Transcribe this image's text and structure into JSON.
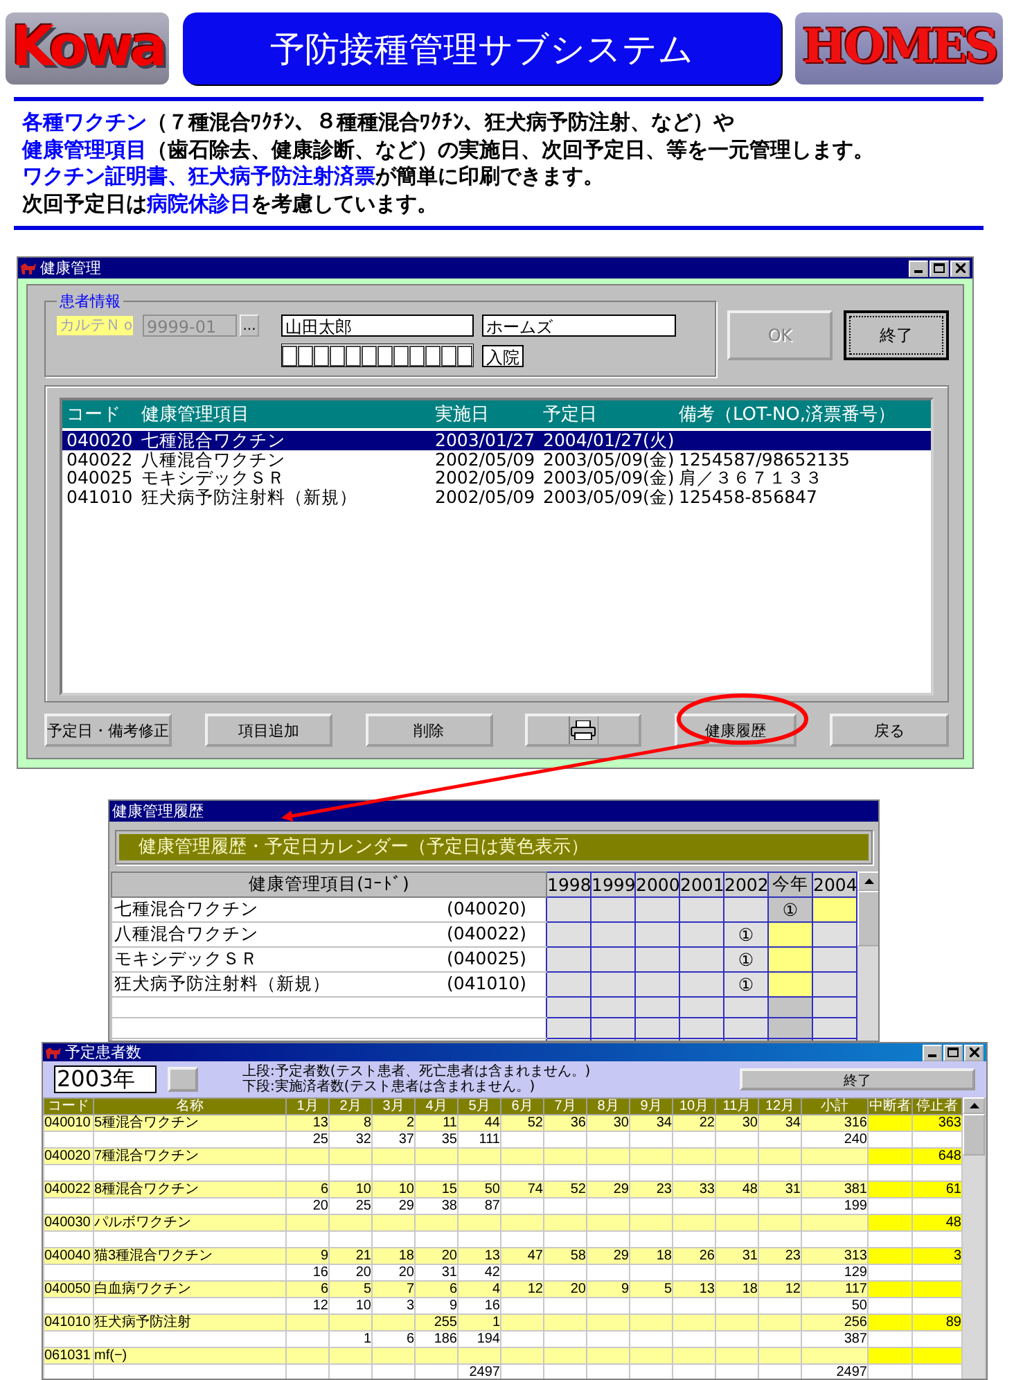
{
  "header": {
    "logo_left": "Kowa",
    "title": "予防接種管理サブシステム",
    "logo_right": "HOMES"
  },
  "intro": [
    [
      {
        "kind": "highlight",
        "text": "各種ワクチン"
      },
      {
        "kind": "plain",
        "text": "（７種混合ﾜｸﾁﾝ、８種種混合ﾜｸﾁﾝ、狂犬病予防注射、など）や"
      }
    ],
    [
      {
        "kind": "highlight",
        "text": "健康管理項目"
      },
      {
        "kind": "plain",
        "text": "（歯石除去、健康診断、など）の実施日、次回予定日、等を一元管理します。"
      }
    ],
    [
      {
        "kind": "highlight",
        "text": "ワクチン証明書、狂犬病予防注射済票"
      },
      {
        "kind": "plain",
        "text": "が簡単に印刷できます。"
      }
    ],
    [
      {
        "kind": "plain",
        "text": "次回予定日は"
      },
      {
        "kind": "highlight",
        "text": "病院休診日"
      },
      {
        "kind": "plain",
        "text": "を考慮しています。"
      }
    ]
  ],
  "health_window": {
    "title": "健康管理",
    "has_controls": true,
    "group": "患者情報",
    "karte_label": "カルテＮｏ",
    "karte_no": "9999-01",
    "browse": "...",
    "name": "山田太郎",
    "kana": "ホームズ",
    "status": "入院",
    "top_buttons": [
      {
        "label": "OK",
        "disabled": true
      },
      {
        "label": "終了",
        "disabled": false
      }
    ],
    "list": {
      "columns": [
        "コード",
        "健康管理項目",
        "実施日",
        "予定日",
        "備考（LOT-NO,済票番号）"
      ],
      "rows": [
        {
          "code": "040020",
          "item": "七種混合ワクチン",
          "done": "2003/01/27",
          "next": "2004/01/27(火)",
          "selected": true
        },
        {
          "code": "040022",
          "item": "八種混合ワクチン",
          "done": "2002/05/09",
          "next": "2003/05/09(金)",
          "note": "1254587/98652135",
          "selected": false
        },
        {
          "code": "040025",
          "item": "モキシデックＳＲ",
          "done": "2002/05/09",
          "next": "2003/05/09(金)",
          "note": "肩／３６７１３３",
          "selected": false
        },
        {
          "code": "041010",
          "item": "狂犬病予防注射料（新規）",
          "done": "2002/05/09",
          "next": "2003/05/09(金)",
          "note": "125458-856847",
          "selected": false
        }
      ]
    },
    "bottom_buttons": [
      {
        "kind": "text",
        "label": "予定日・備考修正"
      },
      {
        "kind": "text",
        "label": "項目追加"
      },
      {
        "kind": "text",
        "label": "削除"
      },
      {
        "kind": "print"
      },
      {
        "kind": "text",
        "label": "健康履歴"
      },
      {
        "kind": "text",
        "label": "戻る"
      }
    ]
  },
  "history_window": {
    "title": "健康管理履歴",
    "banner": "健康管理履歴・予定日カレンダー（予定日は黄色表示）",
    "item_header": "健康管理項目(ｺｰﾄﾞ)",
    "years": [
      {
        "label": "1998",
        "current": false
      },
      {
        "label": "1999",
        "current": false
      },
      {
        "label": "2000",
        "current": false
      },
      {
        "label": "2001",
        "current": false
      },
      {
        "label": "2002",
        "current": false
      },
      {
        "label": "今年",
        "current": true
      },
      {
        "label": "2004",
        "current": false
      }
    ],
    "rows": [
      {
        "name": "七種混合ワクチン",
        "code": "(040020)",
        "cells": [
          {
            "scheduled": false
          },
          {
            "scheduled": false
          },
          {
            "scheduled": false
          },
          {
            "scheduled": false
          },
          {
            "scheduled": false
          },
          {
            "entry": "①",
            "scheduled": false
          },
          {
            "scheduled": true
          }
        ]
      },
      {
        "name": "八種混合ワクチン",
        "code": "(040022)",
        "cells": [
          {
            "scheduled": false
          },
          {
            "scheduled": false
          },
          {
            "scheduled": false
          },
          {
            "scheduled": false
          },
          {
            "entry": "①",
            "scheduled": false
          },
          {
            "scheduled": true
          },
          {
            "scheduled": false
          }
        ]
      },
      {
        "name": "モキシデックＳＲ",
        "code": "(040025)",
        "cells": [
          {
            "scheduled": false
          },
          {
            "scheduled": false
          },
          {
            "scheduled": false
          },
          {
            "scheduled": false
          },
          {
            "entry": "①",
            "scheduled": false
          },
          {
            "scheduled": true
          },
          {
            "scheduled": false
          }
        ]
      },
      {
        "name": "狂犬病予防注射料（新規）",
        "code": "(041010)",
        "cells": [
          {
            "scheduled": false
          },
          {
            "scheduled": false
          },
          {
            "scheduled": false
          },
          {
            "scheduled": false
          },
          {
            "entry": "①",
            "scheduled": false
          },
          {
            "scheduled": true
          },
          {
            "scheduled": false
          }
        ]
      }
    ]
  },
  "schedule_window": {
    "title": "予定患者数",
    "has_controls": true,
    "year": "2003年",
    "legend": [
      "上段:予定者数(テスト患者、死亡患者は含まれません。)",
      "下段:実施済者数(テスト患者は含まれません。)"
    ],
    "close": "終了",
    "columns": [
      "コード",
      "名称",
      "1月",
      "2月",
      "3月",
      "4月",
      "5月",
      "6月",
      "7月",
      "8月",
      "9月",
      "10月",
      "11月",
      "12月",
      "小計",
      "中断者",
      "停止者"
    ],
    "rows": [
      {
        "code": "040010",
        "name": "5種混合ワクチン",
        "stopped": "363",
        "planned": {
          "m1": "13",
          "m2": "8",
          "m3": "2",
          "m4": "11",
          "m5": "44",
          "m6": "52",
          "m7": "36",
          "m8": "30",
          "m9": "34",
          "m10": "22",
          "m11": "30",
          "m12": "34",
          "subtotal": "316"
        },
        "done": {
          "m1": "25",
          "m2": "32",
          "m3": "37",
          "m4": "35",
          "m5": "111",
          "subtotal": "240"
        }
      },
      {
        "code": "040020",
        "name": "7種混合ワクチン",
        "stopped": "648"
      },
      {
        "code": "040022",
        "name": "8種混合ワクチン",
        "stopped": "61",
        "planned": {
          "m1": "6",
          "m2": "10",
          "m3": "10",
          "m4": "15",
          "m5": "50",
          "m6": "74",
          "m7": "52",
          "m8": "29",
          "m9": "23",
          "m10": "33",
          "m11": "48",
          "m12": "31",
          "subtotal": "381"
        },
        "done": {
          "m1": "20",
          "m2": "25",
          "m3": "29",
          "m4": "38",
          "m5": "87",
          "subtotal": "199"
        }
      },
      {
        "code": "040030",
        "name": "パルボワクチン",
        "stopped": "48"
      },
      {
        "code": "040040",
        "name": "猫3種混合ワクチン",
        "stopped": "3",
        "planned": {
          "m1": "9",
          "m2": "21",
          "m3": "18",
          "m4": "20",
          "m5": "13",
          "m6": "47",
          "m7": "58",
          "m8": "29",
          "m9": "18",
          "m10": "26",
          "m11": "31",
          "m12": "23",
          "subtotal": "313"
        },
        "done": {
          "m1": "16",
          "m2": "20",
          "m3": "20",
          "m4": "31",
          "m5": "42",
          "subtotal": "129"
        }
      },
      {
        "code": "040050",
        "name": "白血病ワクチン",
        "planned": {
          "m1": "6",
          "m2": "5",
          "m3": "7",
          "m4": "6",
          "m5": "4",
          "m6": "12",
          "m7": "20",
          "m8": "9",
          "m9": "5",
          "m10": "13",
          "m11": "18",
          "m12": "12",
          "subtotal": "117"
        },
        "done": {
          "m1": "12",
          "m2": "10",
          "m3": "3",
          "m4": "9",
          "m5": "16",
          "subtotal": "50"
        }
      },
      {
        "code": "041010",
        "name": "狂犬病予防注射",
        "stopped": "89",
        "planned": {
          "m4": "255",
          "m5": "1",
          "subtotal": "256"
        },
        "done": {
          "m2": "1",
          "m3": "6",
          "m4": "186",
          "m5": "194",
          "subtotal": "387"
        }
      },
      {
        "code": "061031",
        "name": "mf(−)",
        "done": {
          "m5": "2497",
          "subtotal": "2497"
        }
      }
    ]
  }
}
